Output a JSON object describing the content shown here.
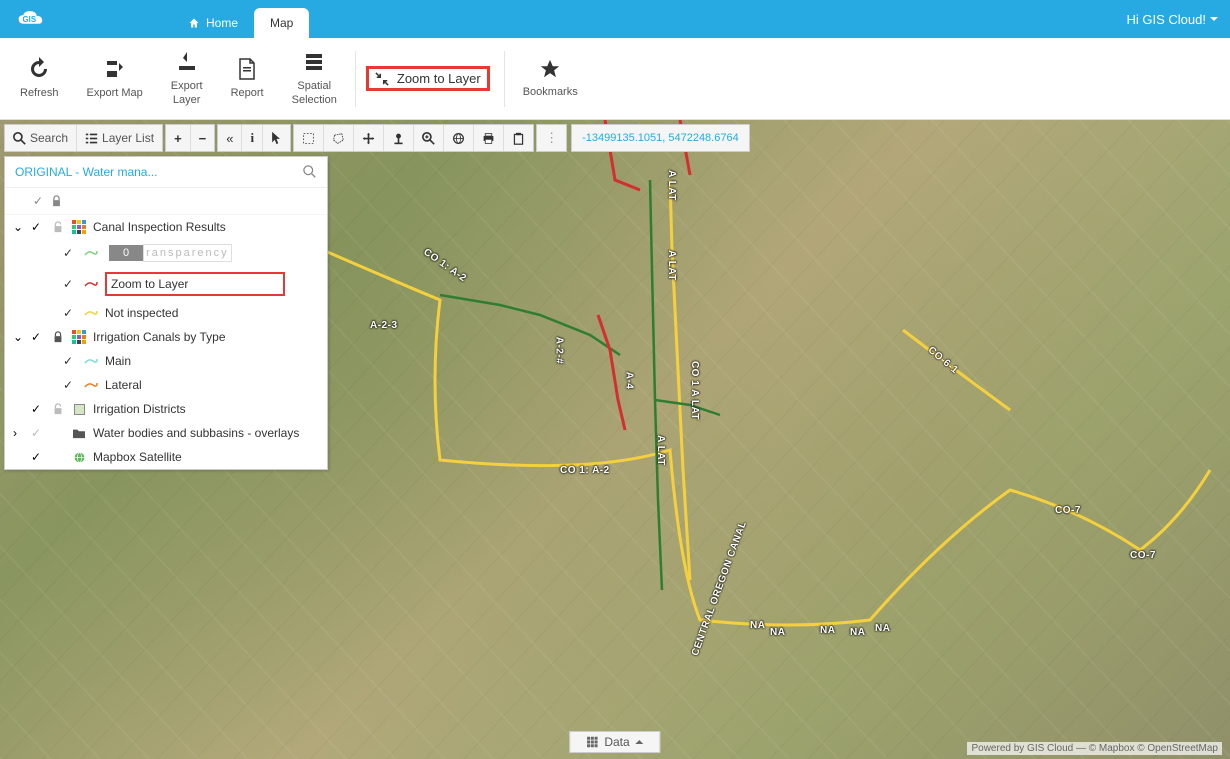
{
  "header": {
    "logo_text": "GIS",
    "nav": {
      "home": "Home",
      "map": "Map"
    },
    "greeting": "Hi GIS Cloud!"
  },
  "ribbon": {
    "refresh": "Refresh",
    "export_map": "Export Map",
    "export_layer": "Export\nLayer",
    "report": "Report",
    "spatial_selection": "Spatial\nSelection",
    "zoom_to_layer": "Zoom to Layer",
    "bookmarks": "Bookmarks"
  },
  "map_controls": {
    "search": "Search",
    "layer_list": "Layer List",
    "coords": "-13499135.1051, 5472248.6764"
  },
  "layer_panel": {
    "title": "ORIGINAL - Water mana...",
    "groups": [
      {
        "name": "Canal Inspection Results",
        "expanded": true,
        "locked": false,
        "children": [
          {
            "name_key": "transparency_row",
            "value": "0",
            "placeholder": "ransparency"
          },
          {
            "name": "Zoom to Layer",
            "highlight": true,
            "symbol_color": "#e53935"
          },
          {
            "name": "Not inspected",
            "symbol_color": "#f4d03f"
          }
        ]
      },
      {
        "name": "Irrigation Canals by Type",
        "expanded": true,
        "locked": true,
        "children": [
          {
            "name": "Main",
            "symbol_color": "#7fdbda"
          },
          {
            "name": "Lateral",
            "symbol_color": "#e67e22"
          }
        ]
      },
      {
        "name": "Irrigation Districts",
        "standalone": true,
        "locked": false,
        "symbol": "square"
      },
      {
        "name": "Water bodies and subbasins - overlays",
        "standalone": true,
        "folder": true,
        "chevron": "right"
      },
      {
        "name": "Mapbox Satellite",
        "standalone": true,
        "symbol": "globe"
      }
    ]
  },
  "bottom": {
    "data_label": "Data",
    "attribution": "Powered by GIS Cloud — © Mapbox © OpenStreetMap"
  },
  "map_labels": [
    "CO 1: A-2",
    "A LAT",
    "A LAT",
    "A-2-3",
    "A-2-#",
    "CO 1: A-2",
    "A LAT",
    "A-4",
    "CO 1 A LAT",
    "CO-6-1",
    "CO-7",
    "CO-7",
    "NA",
    "NA",
    "NA",
    "NA",
    "NA",
    "CENTRAL OREGON CANAL"
  ],
  "colors": {
    "primary": "#26aae1",
    "highlight": "#e53935",
    "canal_yellow": "#f4d03f",
    "canal_red": "#d32f2f",
    "canal_green": "#2e7d32"
  }
}
